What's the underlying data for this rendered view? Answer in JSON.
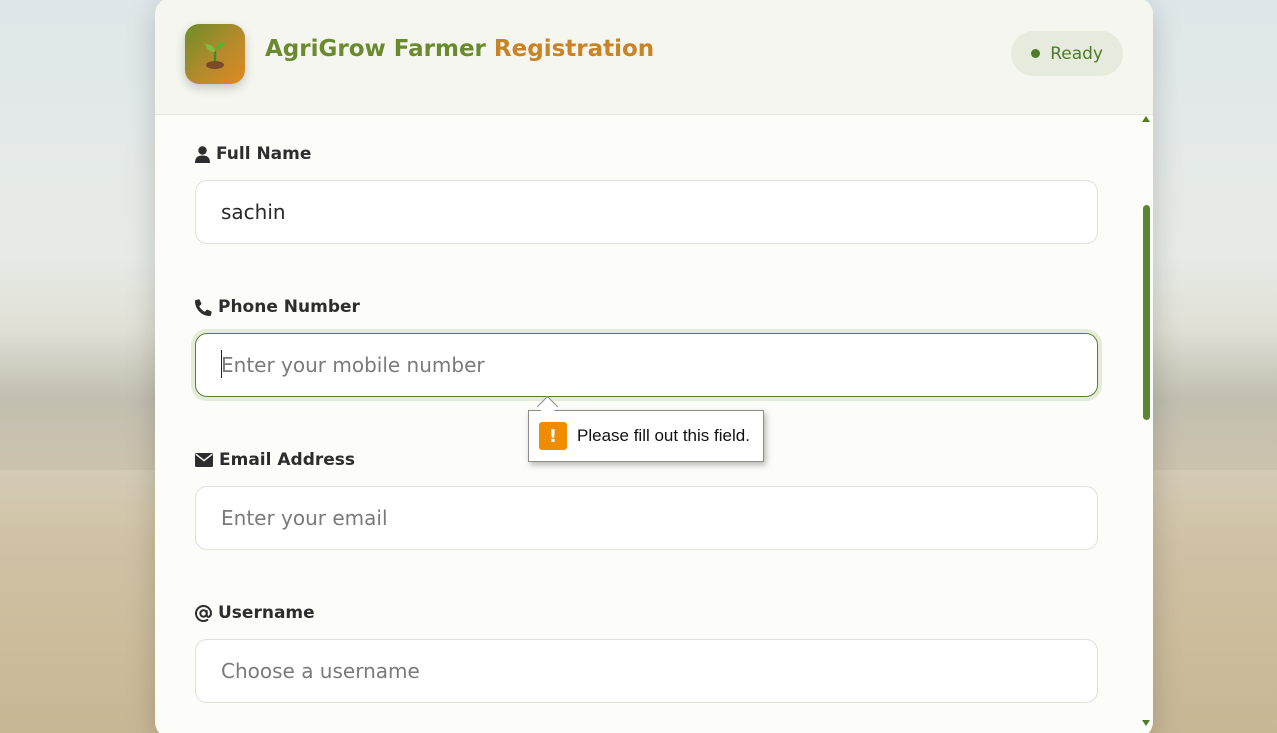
{
  "header": {
    "title_part1": "AgriGrow Farmer",
    "title_part2": "Registration",
    "status": "Ready",
    "logo_icon": "seedling-icon"
  },
  "form": {
    "full_name": {
      "label": "Full Name",
      "icon": "user-icon",
      "value": "sachin",
      "placeholder": ""
    },
    "phone": {
      "label": "Phone Number",
      "icon": "phone-icon",
      "value": "",
      "placeholder": "Enter your mobile number"
    },
    "email": {
      "label": "Email Address",
      "icon": "envelope-icon",
      "value": "",
      "placeholder": "Enter your email"
    },
    "username": {
      "label": "Username",
      "icon": "at-icon",
      "value": "",
      "placeholder": "Choose a username"
    }
  },
  "validation_tooltip": {
    "message": "Please fill out this field.",
    "icon": "warning-icon"
  },
  "colors": {
    "brand_green": "#6b8a2f",
    "brand_orange": "#c98225",
    "status_green": "#4e7a2a",
    "warning_orange": "#f08c00"
  }
}
